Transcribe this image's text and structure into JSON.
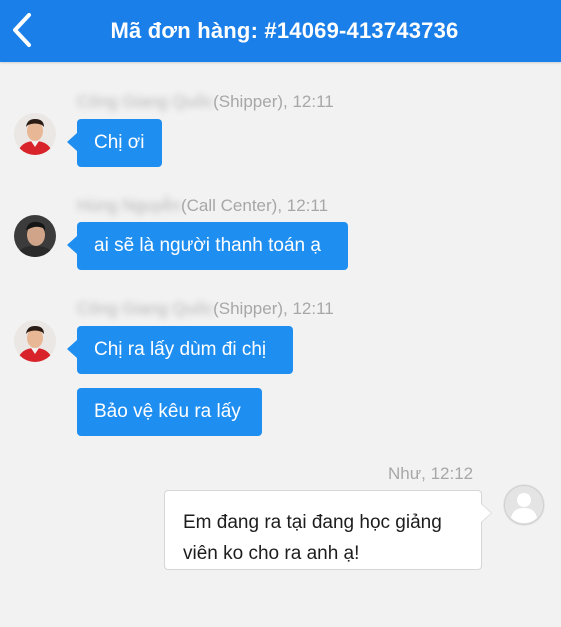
{
  "header": {
    "title": "Mã đơn hàng: #14069-413743736",
    "back_icon": "chevron-left-icon",
    "background": "#1a7fe8"
  },
  "messages": [
    {
      "sender_name": "Công Giang Quốc",
      "role": "(Shipper), 12:11",
      "avatar": "shipper-avatar",
      "bubbles": [
        "Chị ơi"
      ]
    },
    {
      "sender_name": "Hùng Nguyễn",
      "role": "(Call Center), 12:11",
      "avatar": "call-center-avatar",
      "bubbles": [
        "ai sẽ là người thanh toán ạ"
      ]
    },
    {
      "sender_name": "Công Giang Quốc",
      "role": "(Shipper), 12:11",
      "avatar": "shipper-avatar",
      "bubbles": [
        "Chị ra lấy dùm đi chị",
        "Bảo vệ kêu ra lấy"
      ]
    },
    {
      "sender_name": "Như",
      "role": ", 12:12",
      "avatar": "default-user-avatar",
      "bubbles": [
        "Em đang ra tại đang học giảng viên ko cho ra anh ạ!"
      ]
    }
  ],
  "colors": {
    "incoming_bubble": "#1f8ef1",
    "outgoing_bubble": "#ffffff",
    "meta_text": "#a7a7a7"
  }
}
